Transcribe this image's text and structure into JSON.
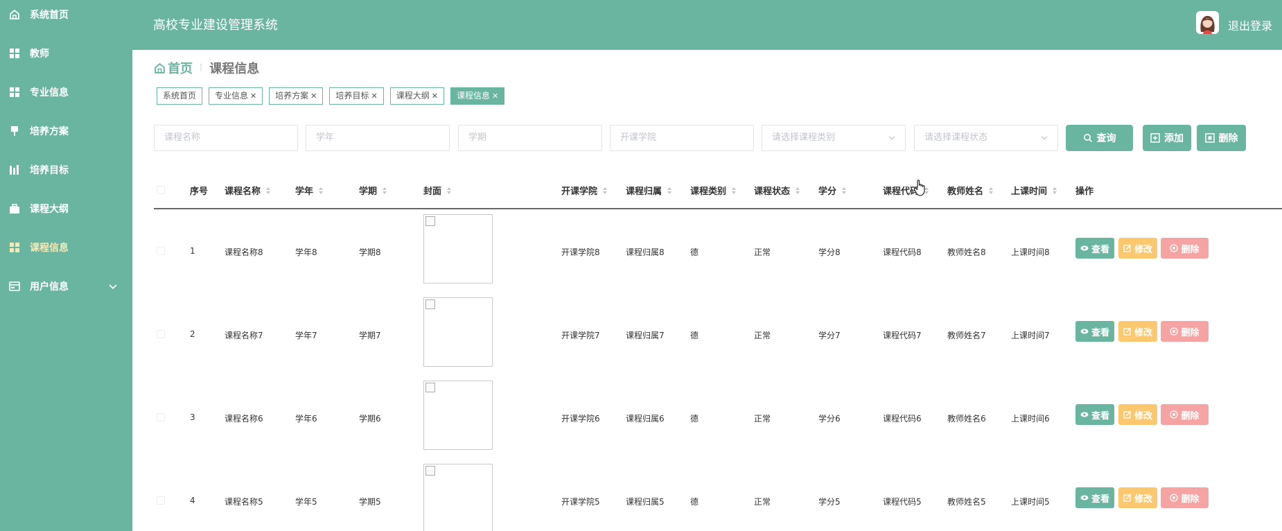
{
  "sidebar": {
    "items": [
      {
        "label": "系统首页",
        "icon": "home-icon"
      },
      {
        "label": "教师",
        "icon": "grid-icon"
      },
      {
        "label": "专业信息",
        "icon": "grid-icon"
      },
      {
        "label": "培养方案",
        "icon": "pin-icon"
      },
      {
        "label": "培养目标",
        "icon": "chart-icon"
      },
      {
        "label": "课程大纲",
        "icon": "briefcase-icon"
      },
      {
        "label": "课程信息",
        "icon": "grid-icon"
      },
      {
        "label": "用户信息",
        "icon": "card-icon"
      }
    ]
  },
  "header": {
    "title": "高校专业建设管理系统",
    "logout": "退出登录"
  },
  "breadcrumb": {
    "home": "首页",
    "current": "课程信息"
  },
  "tags": [
    {
      "label": "系统首页",
      "closable": false
    },
    {
      "label": "专业信息",
      "closable": true
    },
    {
      "label": "培养方案",
      "closable": true
    },
    {
      "label": "培养目标",
      "closable": true
    },
    {
      "label": "课程大纲",
      "closable": true
    },
    {
      "label": "课程信息",
      "closable": true
    }
  ],
  "search": {
    "course_name": "课程名称",
    "year": "学年",
    "term": "学期",
    "college": "开课学院",
    "category": "请选择课程类别",
    "status": "请选择课程状态",
    "query": "查询",
    "add": "添加",
    "delete": "删除"
  },
  "table": {
    "headers": {
      "index": "序号",
      "name": "课程名称",
      "year": "学年",
      "term": "学期",
      "cover": "封面",
      "college": "开课学院",
      "owner": "课程归属",
      "category": "课程类别",
      "status": "课程状态",
      "credit": "学分",
      "code": "课程代码",
      "teacher": "教师姓名",
      "time": "上课时间",
      "ops": "操作"
    },
    "ops": {
      "view": "查看",
      "edit": "修改",
      "delete": "删除"
    },
    "rows": [
      {
        "index": "1",
        "name": "课程名称8",
        "year": "学年8",
        "term": "学期8",
        "college": "开课学院8",
        "owner": "课程归属8",
        "category": "德",
        "status": "正常",
        "credit": "学分8",
        "code": "课程代码8",
        "teacher": "教师姓名8",
        "time": "上课时间8"
      },
      {
        "index": "2",
        "name": "课程名称7",
        "year": "学年7",
        "term": "学期7",
        "college": "开课学院7",
        "owner": "课程归属7",
        "category": "德",
        "status": "正常",
        "credit": "学分7",
        "code": "课程代码7",
        "teacher": "教师姓名7",
        "time": "上课时间7"
      },
      {
        "index": "3",
        "name": "课程名称6",
        "year": "学年6",
        "term": "学期6",
        "college": "开课学院6",
        "owner": "课程归属6",
        "category": "德",
        "status": "正常",
        "credit": "学分6",
        "code": "课程代码6",
        "teacher": "教师姓名6",
        "time": "上课时间6"
      },
      {
        "index": "4",
        "name": "课程名称5",
        "year": "学年5",
        "term": "学期5",
        "college": "开课学院5",
        "owner": "课程归属5",
        "category": "德",
        "status": "正常",
        "credit": "学分5",
        "code": "课程代码5",
        "teacher": "教师姓名5",
        "time": "上课时间5"
      }
    ]
  },
  "colors": {
    "primary": "#69b5a0",
    "warning": "#fbc86f",
    "danger": "#f5a3a3",
    "active_menu": "#f5e9b8"
  }
}
